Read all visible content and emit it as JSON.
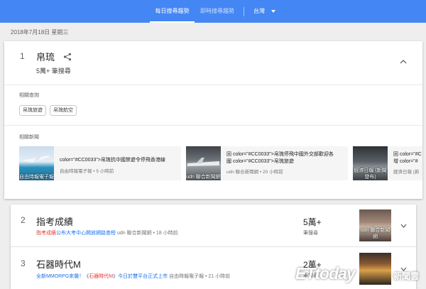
{
  "header": {
    "tabs": [
      {
        "label": "每日搜尋趨勢",
        "active": true
      },
      {
        "label": "即時搜尋趨勢",
        "active": false
      }
    ],
    "region": "台灣",
    "colors": {
      "bar": "#4486f4"
    }
  },
  "date": "2018年7月18日 星期三",
  "trends": [
    {
      "rank": "1",
      "title": "帛琉",
      "searches": "5萬+ 筆搜尋",
      "related_queries_label": "相關查詢",
      "related_queries": [
        "帛琉旅遊",
        "帛琉航空"
      ],
      "related_news_label": "相關新聞",
      "news": [
        {
          "thumb_caption": "自由時報電子報",
          "title_lines": [
            "color=\"#CC0033\">帛琉抗中國禁遊令停飛香港線"
          ],
          "source": "自由時報電子報 • 5 小時前"
        },
        {
          "thumb_caption": "udn 聯合新聞網",
          "title_lines": [
            "回 color=\"#CC0033\">帛琉停飛中國外交部歡迎各",
            "國 color=\"#CC0033\">帛琉旅遊"
          ],
          "source": "udn 聯合新聞網 • 20 小時前"
        },
        {
          "thumb_caption": "經濟日報 (新聞發布)",
          "title_lines": [
            "回 color=\"#C",
            "增 color=\"#"
          ],
          "source": "經濟日報 (新"
        }
      ]
    },
    {
      "rank": "2",
      "title": "指考成績",
      "related_red": "指考成績",
      "related_blue": "公布大考中心開放網路查榜",
      "related_meta": "udn 聯合新聞網 • 18 小時前",
      "count": "5萬+",
      "count_label": "筆搜尋",
      "thumb_caption": "udn 聯合新聞網"
    },
    {
      "rank": "3",
      "title": "石器時代M",
      "related_blue_a": "全新MMORPG來襲！《",
      "related_red": "石器時代M",
      "related_blue_b": "》今日於雙平台正式上市",
      "related_meta": "自由時報電子報 • 21 小時前",
      "count": "2萬+",
      "count_label": "筆搜尋"
    }
  ],
  "watermark": {
    "logo": "ETtoday",
    "text": "新聞雲"
  }
}
